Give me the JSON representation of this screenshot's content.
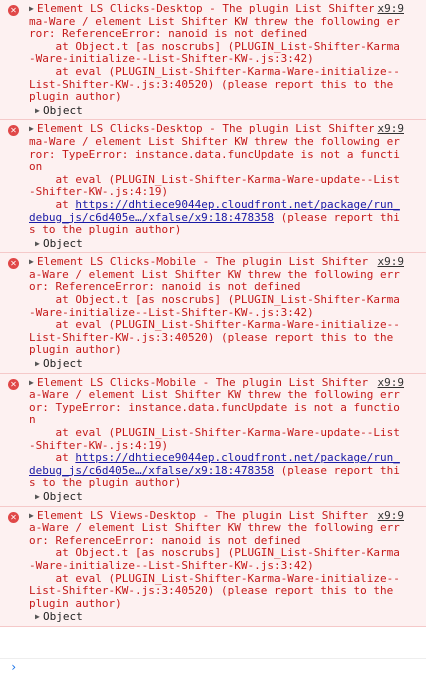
{
  "entries": [
    {
      "source": "x9:9",
      "message": "Element LS Clicks-Desktop - The plugin List Shifter Karma-Ware / element List Shifter KW threw the following error: ReferenceError: nanoid is not defined",
      "stack_lines": [
        {
          "text": "    at Object.t [as noscrubs] (PLUGIN_List-Shifter-Karma-Ware-initialize--List-Shifter-KW-.js:3:42)"
        },
        {
          "text": "    at eval (PLUGIN_List-Shifter-Karma-Ware-initialize--List-Shifter-KW-.js:3:40520) (please report this to the plugin author)"
        }
      ],
      "object_label": "Object"
    },
    {
      "source": "x9:9",
      "message": "Element LS Clicks-Desktop - The plugin List Shifter Karma-Ware / element List Shifter KW threw the following error: TypeError: instance.data.funcUpdate is not a function",
      "stack_lines": [
        {
          "text": "    at eval (PLUGIN_List-Shifter-Karma-Ware-update--List-Shifter-KW-.js:4:19)"
        },
        {
          "prefix": "    at ",
          "link": "https://dhtiece9044ep.cloudfront.net/package/run_debug_js/c6d405e…/xfalse/x9:18:478358",
          "suffix": " (please report this to the plugin author)"
        }
      ],
      "object_label": "Object"
    },
    {
      "source": "x9:9",
      "message": "Element LS Clicks-Mobile - The plugin List Shifter Karma-Ware / element List Shifter KW threw the following error: ReferenceError: nanoid is not defined",
      "stack_lines": [
        {
          "text": "    at Object.t [as noscrubs] (PLUGIN_List-Shifter-Karma-Ware-initialize--List-Shifter-KW-.js:3:42)"
        },
        {
          "text": "    at eval (PLUGIN_List-Shifter-Karma-Ware-initialize--List-Shifter-KW-.js:3:40520) (please report this to the plugin author)"
        }
      ],
      "object_label": "Object"
    },
    {
      "source": "x9:9",
      "message": "Element LS Clicks-Mobile - The plugin List Shifter Karma-Ware / element List Shifter KW threw the following error: TypeError: instance.data.funcUpdate is not a function",
      "stack_lines": [
        {
          "text": "    at eval (PLUGIN_List-Shifter-Karma-Ware-update--List-Shifter-KW-.js:4:19)"
        },
        {
          "prefix": "    at ",
          "link": "https://dhtiece9044ep.cloudfront.net/package/run_debug_js/c6d405e…/xfalse/x9:18:478358",
          "suffix": " (please report this to the plugin author)"
        }
      ],
      "object_label": "Object"
    },
    {
      "source": "x9:9",
      "message": "Element LS Views-Desktop - The plugin List Shifter Karma-Ware / element List Shifter KW threw the following error: ReferenceError: nanoid is not defined",
      "stack_lines": [
        {
          "text": "    at Object.t [as noscrubs] (PLUGIN_List-Shifter-Karma-Ware-initialize--List-Shifter-KW-.js:3:42)"
        },
        {
          "text": "    at eval (PLUGIN_List-Shifter-Karma-Ware-initialize--List-Shifter-KW-.js:3:40520) (please report this to the plugin author)"
        }
      ],
      "object_label": "Object"
    }
  ],
  "prompt": {
    "symbol": "›"
  },
  "colors": {
    "error_text": "#c51a1a",
    "error_bg": "#fdf1f1",
    "error_border": "#f5c9c9",
    "link": "#1a1aa6"
  }
}
